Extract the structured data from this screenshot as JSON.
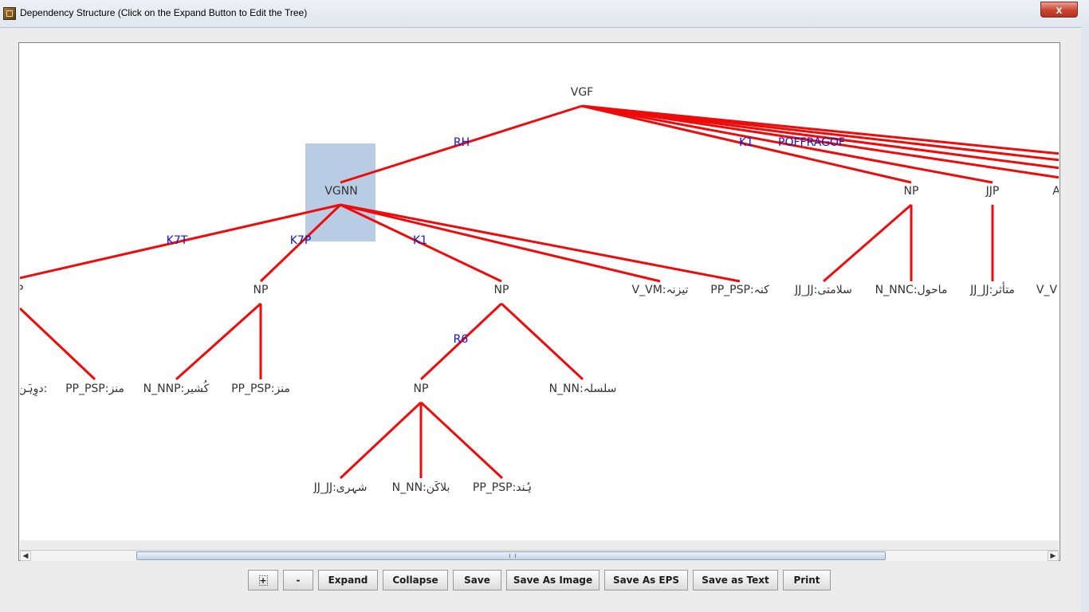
{
  "window": {
    "title": "Dependency Structure (Click on the Expand Button to Edit the Tree)",
    "close_label": "x"
  },
  "tree": {
    "nodes": [
      {
        "id": "vgf",
        "label": "VGF"
      },
      {
        "id": "vgnn",
        "label": "VGNN"
      },
      {
        "id": "np_right",
        "label": "NP"
      },
      {
        "id": "jjp",
        "label": "JJP"
      },
      {
        "id": "cut_a",
        "label": "A"
      },
      {
        "id": "cut_p",
        "label": "P"
      },
      {
        "id": "np_k7p",
        "label": "NP"
      },
      {
        "id": "np_k1",
        "label": "NP"
      },
      {
        "id": "v_vm",
        "label": "V_VM:تیزنہ"
      },
      {
        "id": "pp_psp_top",
        "label": "PP_PSP:کنہ"
      },
      {
        "id": "jj_salamti",
        "label": "JJ_JJ:سلامتی"
      },
      {
        "id": "n_nnc_mahol",
        "label": "N_NNC:ماحول"
      },
      {
        "id": "jj_mutasir",
        "label": "JJ_JJ:متأثر"
      },
      {
        "id": "v_v_cut",
        "label": "V_V"
      },
      {
        "id": "cut_duwan",
        "label": "دوِہَن:"
      },
      {
        "id": "pp_psp_1",
        "label": "PP_PSP:منز"
      },
      {
        "id": "n_nnp_kashir",
        "label": "N_NNP:کُشیر"
      },
      {
        "id": "pp_psp_2",
        "label": "PP_PSP:منز"
      },
      {
        "id": "np_inner",
        "label": "NP"
      },
      {
        "id": "n_nn_silsilah",
        "label": "N_NN:سلسلہ"
      },
      {
        "id": "jj_shahri",
        "label": "JJ_JJ:شہری"
      },
      {
        "id": "n_nn_balakan",
        "label": "N_NN:بلاکَن"
      },
      {
        "id": "pp_psp_hund",
        "label": "PP_PSP:ہُند"
      }
    ],
    "edge_labels": [
      {
        "id": "rh",
        "label": "RH"
      },
      {
        "id": "k1_top",
        "label": "K1"
      },
      {
        "id": "pof",
        "label": "POFFRAGOF"
      },
      {
        "id": "k7t",
        "label": "K7T"
      },
      {
        "id": "k7p",
        "label": "K7P"
      },
      {
        "id": "k1_mid",
        "label": "K1"
      },
      {
        "id": "r6",
        "label": "R6"
      }
    ],
    "colors": {
      "edge": "#ee0b0b",
      "edge_label": "#1414c8",
      "node_text": "#333333",
      "selection": "#b8cde3",
      "background": "#ffffff"
    },
    "selected_node": "VGNN"
  },
  "toolbar": {
    "plus": "+",
    "minus": "-",
    "expand": "Expand",
    "collapse": "Collapse",
    "save": "Save",
    "save_image": "Save As Image",
    "save_eps": "Save As EPS",
    "save_text": "Save as Text",
    "print": "Print"
  },
  "scrollbar": {
    "left_arrow_icon": "◀",
    "right_arrow_icon": "▶"
  }
}
